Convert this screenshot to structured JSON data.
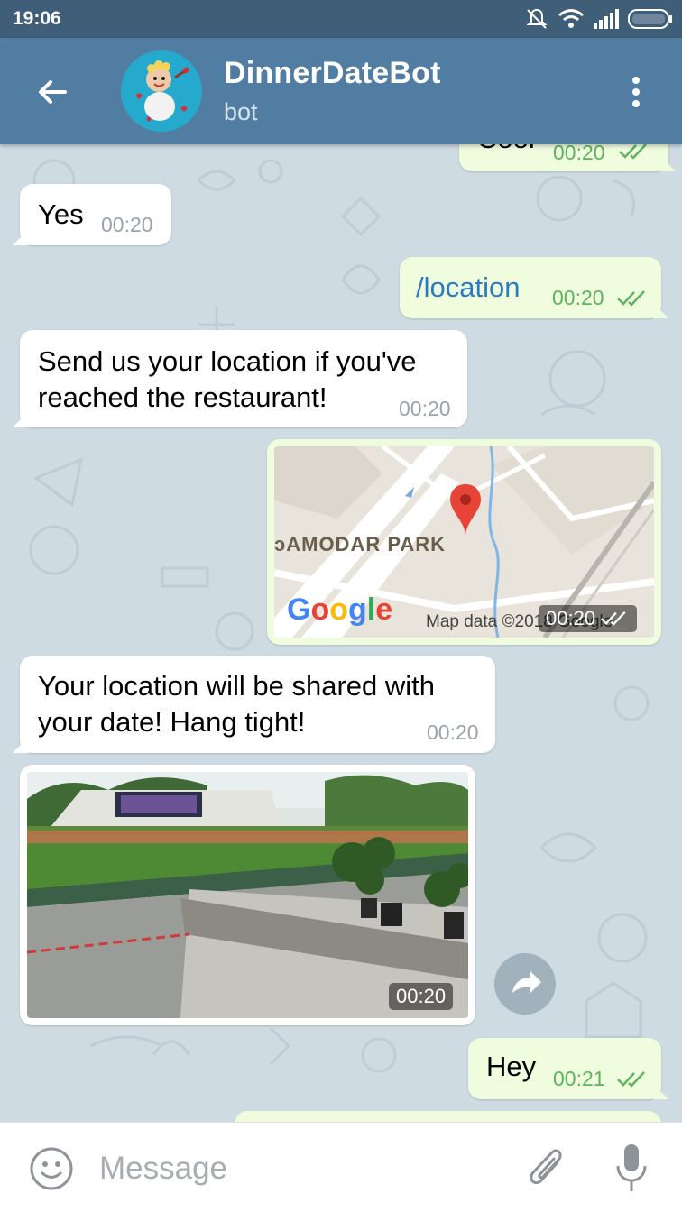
{
  "status_bar": {
    "time": "19:06"
  },
  "header": {
    "title": "DinnerDateBot",
    "subtitle": "bot"
  },
  "messages": [
    {
      "dir": "out",
      "text": "Cool",
      "time": "00:20"
    },
    {
      "dir": "in",
      "text": "Yes",
      "time": "00:20"
    },
    {
      "dir": "out",
      "text": "/location",
      "time": "00:20"
    },
    {
      "dir": "in",
      "text": "Send us your location if you've reached the restaurant!",
      "line1": "Send us your location if you've",
      "line2": "reached the restaurant!",
      "time": "00:20"
    },
    {
      "dir": "out",
      "type": "location",
      "place_label": "DAMODAR PARK",
      "place_label_visible": "ᴐAMODAR PARK",
      "brand": "Google",
      "credit": "Map data ©2018 Google",
      "time": "00:20"
    },
    {
      "dir": "in",
      "text": "Your location will be shared with your date! Hang tight!",
      "line1": "Your location will be shared with",
      "line2": "your date! Hang tight!",
      "time": "00:20"
    },
    {
      "dir": "in",
      "type": "photo",
      "time": "00:20"
    },
    {
      "dir": "out",
      "text": "Hey",
      "time": "00:21"
    }
  ],
  "composer": {
    "placeholder": "Message"
  },
  "colors": {
    "header": "#527da3",
    "status_bar": "#3f5e78",
    "outgoing": "#effdde",
    "incoming": "#ffffff",
    "read_ticks": "#5fb35f"
  },
  "icons": [
    "back-arrow-icon",
    "more-vert-icon",
    "double-check-icon",
    "map-pin-icon",
    "share-icon",
    "emoji-icon",
    "paperclip-icon",
    "mic-icon",
    "wifi-icon",
    "signal-icon",
    "battery-icon",
    "mute-icon"
  ]
}
